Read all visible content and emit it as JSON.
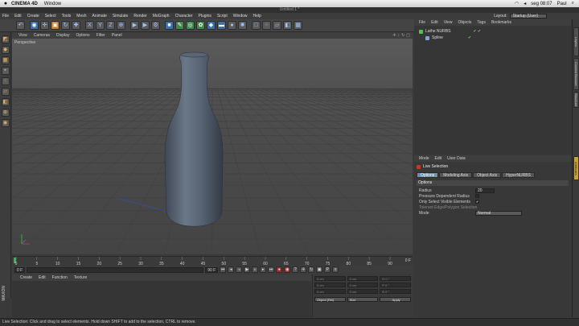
{
  "macmenu": {
    "app": "CINEMA 4D",
    "window": "Window",
    "clock": "seg 08:07",
    "user": "Paul"
  },
  "window_title": "Untitled 1 *",
  "menu": [
    "File",
    "Edit",
    "Create",
    "Select",
    "Tools",
    "Mesh",
    "Animate",
    "Simulate",
    "Render",
    "MoGraph",
    "Character",
    "Plugins",
    "Script",
    "Window",
    "Help"
  ],
  "layout": {
    "label": "Layout:",
    "value": "Startup (User)"
  },
  "viewport": {
    "menu": [
      "View",
      "Cameras",
      "Display",
      "Options",
      "Filter",
      "Panel"
    ],
    "label": "Perspective"
  },
  "timeline": {
    "ticks": [
      "0",
      "5",
      "10",
      "15",
      "20",
      "25",
      "30",
      "35",
      "40",
      "45",
      "50",
      "55",
      "60",
      "65",
      "70",
      "75",
      "80",
      "85",
      "90"
    ],
    "frame_end": "0 F",
    "start_field": "0 F",
    "end_field": "90 F",
    "min_field": "0 F"
  },
  "material": {
    "menu": [
      "Create",
      "Edit",
      "Function",
      "Texture"
    ]
  },
  "coords": {
    "rows": [
      [
        "0 cm",
        "0 cm",
        "H 0 °"
      ],
      [
        "0 cm",
        "0 cm",
        "P 0 °"
      ],
      [
        "0 cm",
        "0 cm",
        "B 0 °"
      ]
    ],
    "mode": "Object (Rel)",
    "size": "Size",
    "apply": "Apply"
  },
  "status": "Live Selection: Click and drag to select elements. Hold down SHIFT to add to the selection, CTRL to remove.",
  "objects": {
    "menu": [
      "File",
      "Edit",
      "View",
      "Objects",
      "Tags",
      "Bookmarks"
    ],
    "items": [
      {
        "name": "Lathe NURBS",
        "color": "#4ec44e"
      },
      {
        "name": "Spline",
        "color": "#7aa7e0"
      }
    ]
  },
  "attributes": {
    "menu": [
      "Mode",
      "Edit",
      "User Data"
    ],
    "tool": "Live Selection",
    "tabs": [
      "Options",
      "Modeling Axis",
      "Object Axis",
      "HyperNURBS"
    ],
    "section": "Options",
    "rows": [
      {
        "label": "Radius",
        "value": "20"
      },
      {
        "label": "Pressure Dependent Radius",
        "check": ""
      },
      {
        "label": "Only Select Visible Elements",
        "check": "✔"
      },
      {
        "label": "Tolerant Edge/Polygon Selection",
        "check": ""
      },
      {
        "label": "Mode",
        "dropdown": "Normal"
      }
    ]
  },
  "sidetabs": [
    "Attributes",
    "Content Browser",
    "Structure",
    "Layers"
  ]
}
